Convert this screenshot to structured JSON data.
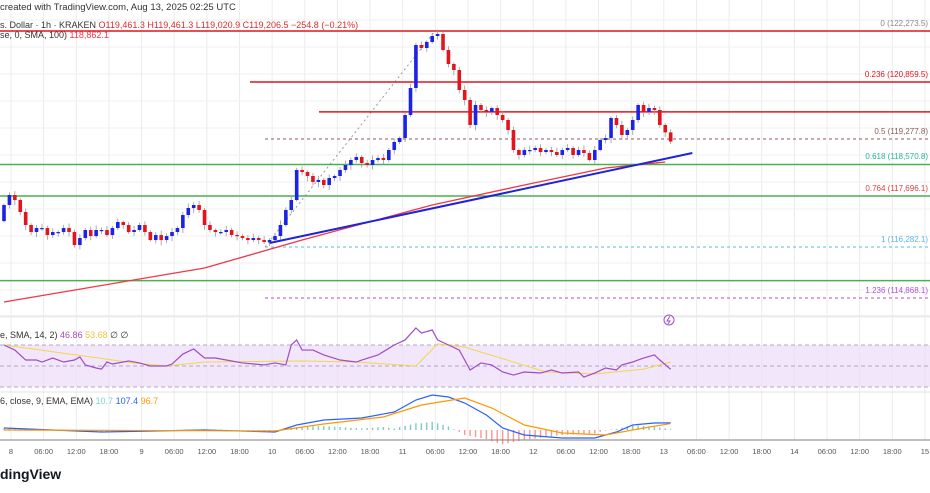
{
  "header": {
    "created": "created with TradingView.com, Aug 13, 2025 02:25 UTC",
    "symbol": "s. Dollar · 1h · KRAKEN",
    "ohlc": "O119,461.3  H119,461.3  L119,020.9  C119,206.5  −254.8 (−0.21%)",
    "sma_label": "se, 0, SMA, 100)",
    "sma_value": "118,862.1"
  },
  "rsi_legend": {
    "label": "e, SMA, 14, 2)",
    "rsi": "46.86",
    "ma": "53.68",
    "extra": "∅ ∅"
  },
  "macd_legend": {
    "label": "6, close, 9, EMA, EMA)",
    "hist": "10.7",
    "macd": "107.4",
    "signal": "96.7"
  },
  "logo": "dingView",
  "colors": {
    "up": "#1a23e6",
    "down": "#e3141d",
    "sma": "#f23645",
    "trend": "#1d24d9",
    "support": "#4caf50",
    "resistance": "#e3141d",
    "rsi": "#a04cc4",
    "rsi_ma": "#f2d64b",
    "rsi_band": "#ecdcfa",
    "macd": "#2962ff",
    "signal": "#ff9800"
  },
  "chart_data": {
    "type": "candlestick",
    "interval": "1h",
    "x_ticks": [
      "8",
      "06:00",
      "12:00",
      "18:00",
      "9",
      "06:00",
      "12:00",
      "18:00",
      "10",
      "06:00",
      "12:00",
      "18:00",
      "11",
      "06:00",
      "12:00",
      "18:00",
      "12",
      "06:00",
      "12:00",
      "18:00",
      "13",
      "06:00",
      "12:00",
      "18:00",
      "14",
      "06:00",
      "12:00",
      "18:00",
      "15"
    ],
    "first_open": 117000,
    "closes": [
      117447,
      117724,
      117585,
      117252,
      116892,
      116697,
      116808,
      116808,
      116614,
      116697,
      116697,
      116808,
      116697,
      116337,
      116531,
      116753,
      116586,
      116753,
      116753,
      116614,
      116808,
      116975,
      116892,
      116697,
      116753,
      116892,
      116697,
      116475,
      116614,
      116475,
      116586,
      116697,
      116808,
      117169,
      117363,
      117447,
      117308,
      116892,
      116753,
      116697,
      116697,
      116753,
      116614,
      116586,
      116531,
      116475,
      116531,
      116475,
      116420,
      116475,
      116586,
      116892,
      117308,
      117585,
      118418,
      118362,
      118251,
      118085,
      118140,
      118001,
      118196,
      118251,
      118418,
      118556,
      118695,
      118778,
      118612,
      118556,
      118695,
      118750,
      118695,
      118972,
      119194,
      119305,
      119943,
      120692,
      121885,
      121802,
      121968,
      122135,
      122190,
      121746,
      121358,
      121192,
      120637,
      120360,
      119666,
      120221,
      120082,
      120026,
      120137,
      119943,
      119805,
      119527,
      118972,
      118834,
      118972,
      118972,
      119028,
      118917,
      118972,
      118917,
      118834,
      118972,
      119028,
      118834,
      118972,
      118889,
      118695,
      118972,
      119250,
      119305,
      119860,
      119666,
      119389,
      119527,
      119805,
      120221,
      120026,
      120137,
      120082,
      119666,
      119461.3,
      119206.5
    ],
    "sma100": [
      [
        0,
        114756
      ],
      [
        37,
        115699
      ],
      [
        55,
        116475
      ],
      [
        79,
        117447
      ],
      [
        96,
        118001
      ],
      [
        111,
        118473
      ],
      [
        122,
        118640
      ]
    ],
    "trendline": [
      [
        49,
        116392
      ],
      [
        127,
        118889
      ]
    ],
    "horizontal_resistance": [
      122273.5,
      120859.5,
      120030
    ],
    "horizontal_support": [
      118570.8,
      117696.1,
      115350
    ],
    "fibonacci": [
      {
        "label": "0 (122,273.5)",
        "price": 122273.5,
        "color": "#888888"
      },
      {
        "label": "0.236 (120,859.5)",
        "price": 120859.5,
        "color": "#e3141d"
      },
      {
        "label": "0.5 (119,277.8)",
        "price": 119277.8,
        "color": "#8d5a5a"
      },
      {
        "label": "0.618 (118,570.8)",
        "price": 118570.8,
        "color": "#26b59a"
      },
      {
        "label": "0.764 (117,696.1)",
        "price": 117696.1,
        "color": "#d84343"
      },
      {
        "label": "1 (116,282.1)",
        "price": 116282.1,
        "color": "#5ab8e8"
      },
      {
        "label": "1.236 (114,868.1)",
        "price": 114868.1,
        "color": "#b04fd6"
      }
    ],
    "rsi": [
      [
        0,
        70
      ],
      [
        2,
        65.2
      ],
      [
        4,
        55.7
      ],
      [
        6,
        55.7
      ],
      [
        7,
        53.8
      ],
      [
        9,
        57.6
      ],
      [
        11,
        53.8
      ],
      [
        13,
        55.7
      ],
      [
        14,
        58.6
      ],
      [
        15,
        51
      ],
      [
        17,
        48.1
      ],
      [
        18,
        47.1
      ],
      [
        19,
        53.8
      ],
      [
        20,
        51.9
      ],
      [
        23,
        54.8
      ],
      [
        25,
        52.9
      ],
      [
        27,
        50
      ],
      [
        30,
        50
      ],
      [
        31,
        51.9
      ],
      [
        33,
        61.4
      ],
      [
        35,
        66.2
      ],
      [
        37,
        57.6
      ],
      [
        39,
        57.6
      ],
      [
        41,
        55.7
      ],
      [
        44,
        52.9
      ],
      [
        48,
        51
      ],
      [
        50,
        52.9
      ],
      [
        52,
        51
      ],
      [
        53,
        70
      ],
      [
        54,
        74.8
      ],
      [
        55,
        65.2
      ],
      [
        57,
        65.2
      ],
      [
        59,
        60.5
      ],
      [
        62,
        55.7
      ],
      [
        65,
        53.8
      ],
      [
        66,
        55.7
      ],
      [
        69,
        60.5
      ],
      [
        72,
        70
      ],
      [
        74,
        74.8
      ],
      [
        76,
        86.2
      ],
      [
        77,
        81.4
      ],
      [
        79,
        84.3
      ],
      [
        80,
        74.8
      ],
      [
        82,
        70
      ],
      [
        84,
        65.2
      ],
      [
        86,
        46.2
      ],
      [
        88,
        52.9
      ],
      [
        90,
        51
      ],
      [
        92,
        44.3
      ],
      [
        94,
        41.4
      ],
      [
        96,
        44.3
      ],
      [
        99,
        43.3
      ],
      [
        101,
        46.2
      ],
      [
        103,
        43.3
      ],
      [
        106,
        44.3
      ],
      [
        107,
        39.5
      ],
      [
        109,
        43.3
      ],
      [
        111,
        48.1
      ],
      [
        113,
        46.2
      ],
      [
        114,
        51
      ],
      [
        116,
        53.8
      ],
      [
        118,
        57.6
      ],
      [
        120,
        60.5
      ],
      [
        121,
        55.7
      ],
      [
        123,
        46.86
      ]
    ],
    "rsi_ma": [
      [
        0,
        70
      ],
      [
        24,
        52.9
      ],
      [
        30,
        50
      ],
      [
        37,
        53.8
      ],
      [
        55,
        54.8
      ],
      [
        65,
        53.8
      ],
      [
        76,
        50
      ],
      [
        80,
        71
      ],
      [
        85,
        68
      ],
      [
        100,
        44.3
      ],
      [
        109,
        42.4
      ],
      [
        118,
        47
      ],
      [
        123,
        53.68
      ]
    ],
    "rsi_levels": [
      70,
      50,
      30
    ],
    "macd": [
      [
        0,
        30
      ],
      [
        18,
        -30
      ],
      [
        37,
        0
      ],
      [
        50,
        -30
      ],
      [
        54,
        75
      ],
      [
        59,
        150
      ],
      [
        66,
        180
      ],
      [
        72,
        270
      ],
      [
        76,
        450
      ],
      [
        79,
        525
      ],
      [
        82,
        495
      ],
      [
        85,
        405
      ],
      [
        89,
        225
      ],
      [
        92,
        30
      ],
      [
        96,
        -75
      ],
      [
        103,
        -120
      ],
      [
        109,
        -120
      ],
      [
        113,
        -30
      ],
      [
        116,
        75
      ],
      [
        120,
        105
      ],
      [
        123,
        107.4
      ]
    ],
    "signal": [
      [
        0,
        0
      ],
      [
        50,
        -15
      ],
      [
        59,
        90
      ],
      [
        70,
        195
      ],
      [
        77,
        375
      ],
      [
        85,
        480
      ],
      [
        90,
        330
      ],
      [
        96,
        75
      ],
      [
        103,
        -45
      ],
      [
        111,
        -75
      ],
      [
        118,
        30
      ],
      [
        123,
        96.7
      ]
    ]
  }
}
